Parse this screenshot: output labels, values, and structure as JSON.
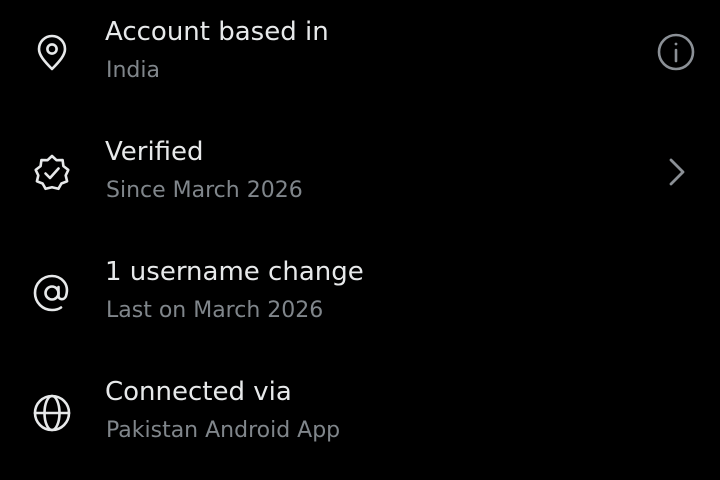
{
  "rows": [
    {
      "title": "Account based in",
      "subtitle": "India",
      "icon": "location-pin-icon",
      "trailing_icon": "info-icon"
    },
    {
      "title": "Verified",
      "subtitle": "Since March 2026",
      "icon": "verified-badge-icon",
      "trailing_icon": "chevron-right-icon"
    },
    {
      "title": "1 username change",
      "subtitle": "Last on March 2026",
      "icon": "at-sign-icon"
    },
    {
      "title": "Connected via",
      "subtitle": "Pakistan Android App",
      "icon": "globe-icon"
    }
  ],
  "colors": {
    "background": "#000000",
    "title": "#e7e9ea",
    "subtitle": "#80868b",
    "icon": "#e7e9ea",
    "trailing_icon": "#8b9096"
  }
}
